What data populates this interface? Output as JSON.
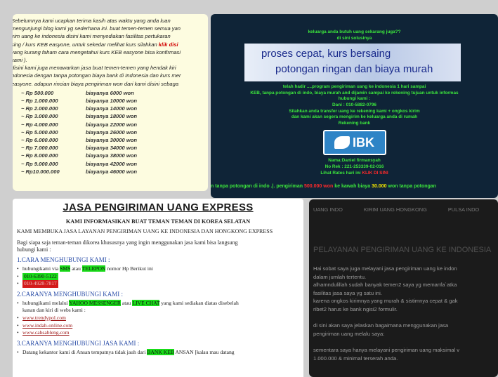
{
  "top_left": {
    "intro_lines": [
      "    Sebelumnya kami ucapkan terima kasih atas waktu yang anda luan",
      "mengunjungi blog kami yg sederhana ini. buat temen-temen semua yan",
      "irim uang ke indonesia disini kami menyediakan fasilitas pertukaran",
      "sing / kurs KEB easyone, untuk sekedar melihat kurs silahkan",
      "yang kurang faham cara mengetahui kurs KEB easyone bisa konfirmasi",
      "kami ).",
      "disini kami juga menawarkan jasa buat temen-temen yang hendak kiri",
      "ndonesia dengan tanpa potongan biaya bank di Indonesia dan kurs mer",
      "easyone. adapun rincian biaya pengiriman won dari kami disini sebaga"
    ],
    "intro_link": "klik disi",
    "rates": [
      {
        "amount": "~ Rp    500.000",
        "fee": "biayanya   6000 won"
      },
      {
        "amount": "~ Rp  1.000.000",
        "fee": "biayanya  10000 won"
      },
      {
        "amount": "~ Rp  2.000.000",
        "fee": "biayanya  14000 won"
      },
      {
        "amount": "~ Rp  3.000.000",
        "fee": "biayanya  18000 won"
      },
      {
        "amount": "~ Rp  4.000.000",
        "fee": "biayanya  22000 won"
      },
      {
        "amount": "~ Rp  5.000.000",
        "fee": "biayanya  26000 won"
      },
      {
        "amount": "~ Rp  6.000.000",
        "fee": "biayanya  30000 won"
      },
      {
        "amount": "~ Rp  7.000.000",
        "fee": "biayanya  34000 won"
      },
      {
        "amount": "~ Rp  8.000.000",
        "fee": "biayanya  38000 won"
      },
      {
        "amount": "~ Rp  9.000.000",
        "fee": "biayanya  42000 won"
      },
      {
        "amount": "~ Rp10.000.000",
        "fee": "biayanya  46000 won"
      }
    ]
  },
  "top_right": {
    "line1": "keluarga anda butuh uang sekarang juga??",
    "line2": "di sini solusinya",
    "banner_line1": "proses cepat, kurs bersaing",
    "banner_line2": "potongan ringan dan biaya murah",
    "info_lines": [
      "telah hadir ....program pengiriman uang ke indonesia 1 hari sampai",
      "KEB, tanpa potongan di indo, biaya murah and dijamin sampai ke rekening tujuan untuk informas",
      "hubungi kami :",
      "Dani : 010-5882-0796",
      "Silahkan anda transfer uang ke rekening kami + ongkos kirim",
      "dan kami akan segera mengirim ke keluarga anda di rumah",
      "Rekening bank"
    ],
    "bank_logo": "IBK",
    "name_line": "Nama:Daniel firmansyah",
    "norek_line": "No Rek : 221-253339-02-016",
    "rates_prefix": "Lihat Rates hari ini ",
    "rates_link": "KLIK DI SINI",
    "ticker_a": "n tanpa potongan di indo .|. pengiriman ",
    "ticker_red1": "500.000 won",
    "ticker_b": " ke kawah biaya ",
    "ticker_yellow": "30.000",
    "ticker_c": " won tanpa potongan"
  },
  "bottom_left": {
    "title": "JASA PENGIRIMAN UANG EXPRESS",
    "subtitle": "KAMI INFORMASIKAN BUAT TEMAN TEMAN DI KOREA SELATAN",
    "intro1": "KAMI MEMBUKA JASA LAYANAN PENGIRIMAN UANG KE INDONESIA DAN HONGKONG EXPRESS",
    "intro2a": "Bagi siapa saja teman-teman dikorea khususnya yang ingin menggunakan jasa kami bisa langsung",
    "intro2b": "hubungi kami :",
    "section1": "1.CARA MENGHUBUNGI KAMI :",
    "s1_text_a": "hubungikami via ",
    "s1_sms": "SMS",
    "s1_text_b": " atau ",
    "s1_tel": "TELEPON",
    "s1_text_c": "  nomor Hp Berikut ini",
    "phone1": "010-6390-5122",
    "phone2": "010-4928-7817",
    "section2": "2.CARANYA MENGHUBUNGI KAMI :",
    "s2_text_a": "hubungikami melalui ",
    "s2_ym": "YAHOO MESSENGER",
    "s2_text_b": " atau ",
    "s2_chat": "LIVE CHAT",
    "s2_text_c": " yang kami sediakan diatas disebelah",
    "s2_text_d": "kanan dan kiri di webs kami :",
    "links": [
      "www.trendypol.com",
      "www.indah-online.com",
      "www.cahsableng.com"
    ],
    "section3": "3.CARANYA MENGHUBUNGI JASA KAMI :",
    "s3_text_a": "Datang kekantor kami di Ansan tempatnya tidak jauh dari ",
    "s3_keb": "BANK KEB",
    "s3_text_b": " ANSAN [kalau mau datang"
  },
  "bottom_right": {
    "nav": [
      "UANG INDO",
      "KIRIM UANG HONGKONG",
      "PULSA INDO"
    ],
    "heading": "PELAYANAN PENGIRIMAN UANG KE INDONESIA",
    "paragraph_lines": [
      "Hai sobat saya juga melayani jasa pengiriman uang ke indon",
      "dalam jumlah tertentu.",
      "alhamndulillah sudah banyak temen2 saya yg memanfa`atka",
      "fasilitas jasa saya yg satu ini.",
      "karena ongkos kirimnya yang murah & sistimnya cepat & gak",
      "ribet2 harus ke bank ngisi2 formulir.",
      "",
      "di sini akan saya jelaskan bagaimana menggunakan jasa",
      "pengiriman uang melalu saya:",
      "",
      "sementara saya hanya melayani pengiriman uang maksimal v",
      "1.000.000 & minimal terserah anda."
    ]
  }
}
